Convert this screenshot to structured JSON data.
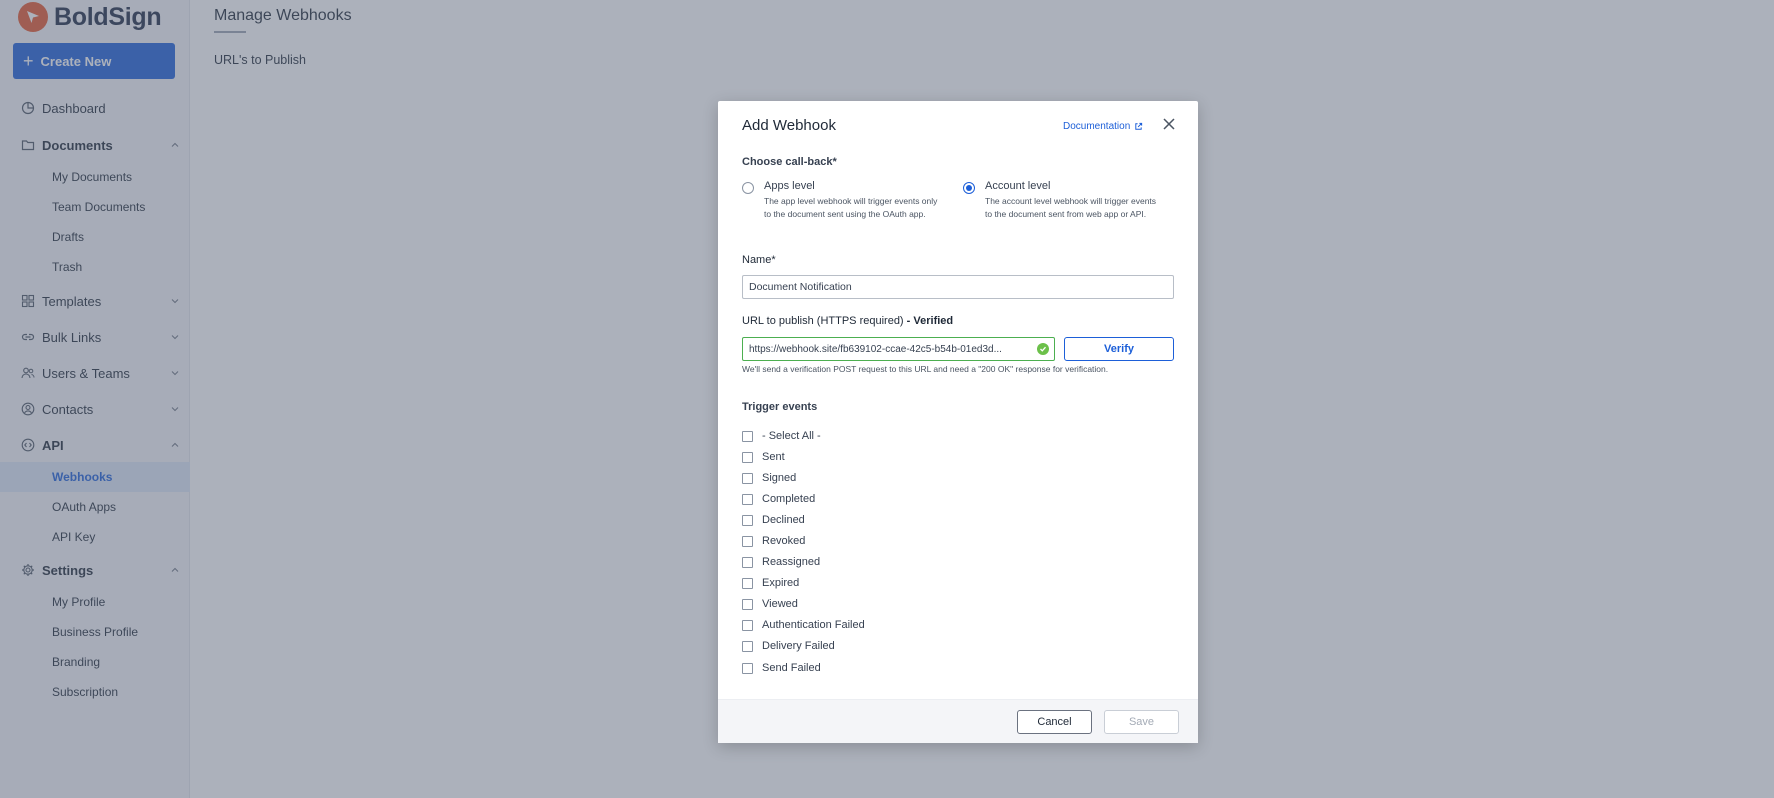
{
  "brand": {
    "name": "BoldSign",
    "color": "#e4572e"
  },
  "sidebar": {
    "create_label": "Create New",
    "nav": [
      {
        "label": "Dashboard",
        "icon": "dashboard-icon"
      },
      {
        "label": "Documents",
        "icon": "folder-icon",
        "expanded": true,
        "children": [
          "My Documents",
          "Team Documents",
          "Drafts",
          "Trash"
        ]
      },
      {
        "label": "Templates",
        "icon": "templates-icon",
        "expanded": false
      },
      {
        "label": "Bulk Links",
        "icon": "link-icon",
        "expanded": false
      },
      {
        "label": "Users & Teams",
        "icon": "users-icon",
        "expanded": false
      },
      {
        "label": "Contacts",
        "icon": "contacts-icon",
        "expanded": false
      },
      {
        "label": "API",
        "icon": "api-icon",
        "expanded": true,
        "children": [
          "Webhooks",
          "OAuth Apps",
          "API Key"
        ],
        "active_child": "Webhooks"
      },
      {
        "label": "Settings",
        "icon": "gear-icon",
        "expanded": true,
        "children": [
          "My Profile",
          "Business Profile",
          "Branding",
          "Subscription"
        ]
      }
    ]
  },
  "main": {
    "title": "Manage Webhooks",
    "section": "URL's to Publish"
  },
  "dialog": {
    "title": "Add Webhook",
    "doc_link": "Documentation",
    "callback_label": "Choose call-back*",
    "apps_level": {
      "title": "Apps level",
      "desc": "The app level webhook will trigger events only to the document sent using the OAuth app."
    },
    "account_level": {
      "title": "Account level",
      "desc": "The account level webhook will trigger events to the document sent from web app or API.",
      "selected": true
    },
    "name_label": "Name*",
    "name_value": "Document Notification",
    "url_label": "URL to publish (HTTPS required)",
    "url_status": " - Verified",
    "url_value": "https://webhook.site/fb639102-ccae-42c5-b54b-01ed3d...",
    "verify_label": "Verify",
    "url_hint": "We'll send a verification POST request to this URL and need a \"200 OK\" response for verification.",
    "trigger_label": "Trigger events",
    "events": [
      "- Select All -",
      "Sent",
      "Signed",
      "Completed",
      "Declined",
      "Revoked",
      "Reassigned",
      "Expired",
      "Viewed",
      "Authentication Failed",
      "Delivery Failed",
      "Send Failed"
    ],
    "cancel_label": "Cancel",
    "save_label": "Save"
  }
}
